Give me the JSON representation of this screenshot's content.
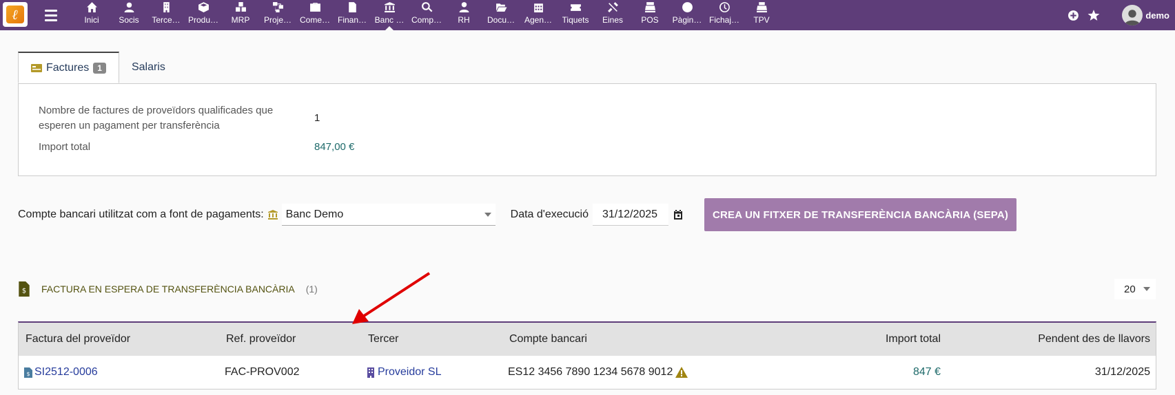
{
  "colors": {
    "topbar": "#5e3d79",
    "button": "#a17bab",
    "link": "#263c9c",
    "amount": "#1e6a6a",
    "section_title": "#545311",
    "annotation_arrow": "#e00000"
  },
  "nav": {
    "items": [
      {
        "label": "Inici",
        "icon": "home-icon"
      },
      {
        "label": "Socis",
        "icon": "user-icon"
      },
      {
        "label": "Terce…",
        "icon": "building-icon"
      },
      {
        "label": "Produ…",
        "icon": "box-icon"
      },
      {
        "label": "MRP",
        "icon": "cubes-icon"
      },
      {
        "label": "Proje…",
        "icon": "sitemap-icon"
      },
      {
        "label": "Come…",
        "icon": "briefcase-icon"
      },
      {
        "label": "Finan…",
        "icon": "invoice-icon"
      },
      {
        "label": "Banc …",
        "icon": "bank-icon"
      },
      {
        "label": "Comp…",
        "icon": "search-dollar-icon"
      },
      {
        "label": "RH",
        "icon": "user-tie-icon"
      },
      {
        "label": "Docu…",
        "icon": "folder-open-icon"
      },
      {
        "label": "Agen…",
        "icon": "calendar-icon"
      },
      {
        "label": "Tiquets",
        "icon": "ticket-icon"
      },
      {
        "label": "Eines",
        "icon": "tools-icon"
      },
      {
        "label": "POS",
        "icon": "cash-register-icon"
      },
      {
        "label": "Pàgin…",
        "icon": "globe-icon"
      },
      {
        "label": "Fichaj…",
        "icon": "clock-icon"
      },
      {
        "label": "TPV",
        "icon": "till-icon"
      }
    ],
    "active_index": 8,
    "user": "demo"
  },
  "tabs": {
    "invoices": "Factures",
    "invoices_badge": "1",
    "salaries": "Salaris"
  },
  "summary": {
    "count_label_line1": "Nombre de factures de proveïdors qualificades que",
    "count_label_line2": "esperen un pagament per transferència",
    "count_value": "1",
    "total_label": "Import total",
    "total_value": "847,00 €"
  },
  "form": {
    "bank_label": "Compte bancari utilitzat com a font de pagaments:",
    "bank_value": "Banc Demo",
    "date_label": "Data d'execució",
    "date_value": "31/12/2025",
    "sepa_button": "CREA UN FITXER DE TRANSFERÈNCIA BANCÀRIA (SEPA)"
  },
  "section": {
    "title": "FACTURA EN ESPERA DE TRANSFERÈNCIA BANCÀRIA",
    "count": "(1)",
    "page_size": "20"
  },
  "table": {
    "headers": {
      "invoice": "Factura del proveïdor",
      "ref": "Ref. proveïdor",
      "thirdparty": "Tercer",
      "account": "Compte bancari",
      "amount": "Import total",
      "pending": "Pendent des de llavors"
    },
    "rows": [
      {
        "invoice": "SI2512-0006",
        "ref": "FAC-PROV002",
        "thirdparty": "Proveidor SL",
        "account": "ES12 3456 7890 1234 5678 9012",
        "amount": "847 €",
        "pending": "31/12/2025"
      }
    ]
  }
}
